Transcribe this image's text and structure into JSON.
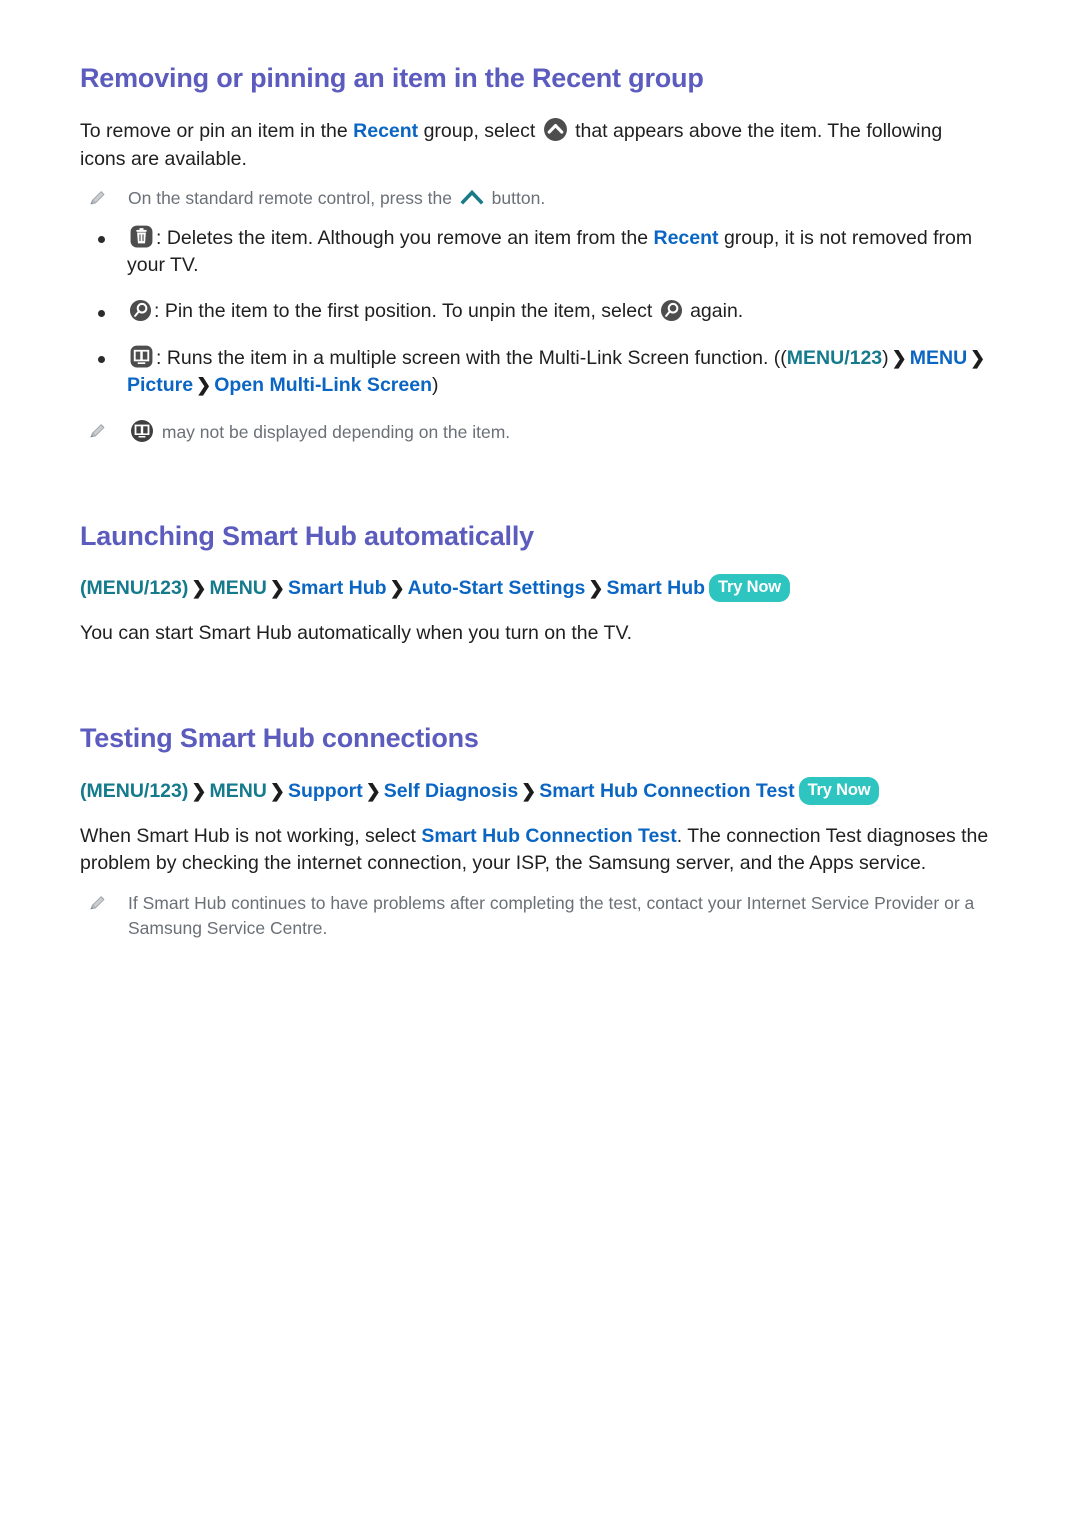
{
  "page": {
    "background": "#ffffff",
    "heading_color": "#5c5cbe",
    "link_blue": "#0b66c3",
    "link_teal": "#147a8c",
    "badge_teal": "#2ec4bf",
    "note_gray": "#6b7077"
  },
  "sections": [
    {
      "id": "removing-pinning",
      "title": "Removing or pinning an item in the Recent group",
      "intro": {
        "part1": "To remove or pin an item in the ",
        "link1": "Recent",
        "part2": " group, select ",
        "icon1": "chevron-up-circle-icon",
        "part3": " that appears above the item. The following icons are available."
      },
      "note": {
        "icon": "pencil-icon",
        "part1": "On the standard remote control, press the ",
        "icon_inline": "chevron-up-teal-icon",
        "part2": " button."
      },
      "bullets": [
        {
          "icon": "trash-icon",
          "part1": ": Deletes the item. Although you remove an item from the ",
          "link": "Recent",
          "part2": " group, it is not removed from your TV."
        },
        {
          "icon": "pin-icon",
          "part1": ": Pin the item to the first position. To unpin the item, select ",
          "icon2": "pin-icon",
          "part2": " again."
        },
        {
          "icon": "multi-link-screen-icon",
          "part1": ": Runs the item in a multiple screen with the Multi-Link Screen function. ((",
          "path": [
            "MENU/123",
            "MENU",
            "Picture",
            "Open Multi-Link Screen"
          ],
          "part2": ")"
        }
      ],
      "note2": {
        "icon": "pencil-icon",
        "icon_inline": "multi-link-screen-circle-icon",
        "text": " may not be displayed depending on the item."
      }
    },
    {
      "id": "launching-smart-hub",
      "title": "Launching Smart Hub automatically",
      "menu_path": {
        "items": [
          {
            "label": "(MENU/123)",
            "style": "teal"
          },
          {
            "label": "MENU",
            "style": "teal"
          },
          {
            "label": "Smart Hub",
            "style": "blue"
          },
          {
            "label": "Auto-Start Settings",
            "style": "blue"
          },
          {
            "label": "Smart Hub",
            "style": "blue"
          }
        ],
        "badge": "Try Now",
        "separator": "❯"
      },
      "paragraph": "You can start Smart Hub automatically when you turn on the TV."
    },
    {
      "id": "testing-smart-hub",
      "title": "Testing Smart Hub connections",
      "menu_path": {
        "items": [
          {
            "label": "(MENU/123)",
            "style": "teal"
          },
          {
            "label": "MENU",
            "style": "teal"
          },
          {
            "label": "Support",
            "style": "blue"
          },
          {
            "label": "Self Diagnosis",
            "style": "blue"
          },
          {
            "label": "Smart Hub Connection Test",
            "style": "blue"
          }
        ],
        "badge": "Try Now",
        "separator": "❯"
      },
      "paragraph": {
        "part1": "When Smart Hub is not working, select ",
        "link": "Smart Hub Connection Test",
        "part2": ". The connection Test diagnoses the problem by checking the internet connection, your ISP, the Samsung server, and the Apps service."
      },
      "note": {
        "icon": "pencil-icon",
        "text": "If Smart Hub continues to have problems after completing the test, contact your Internet Service Provider or a Samsung Service Centre."
      }
    }
  ]
}
